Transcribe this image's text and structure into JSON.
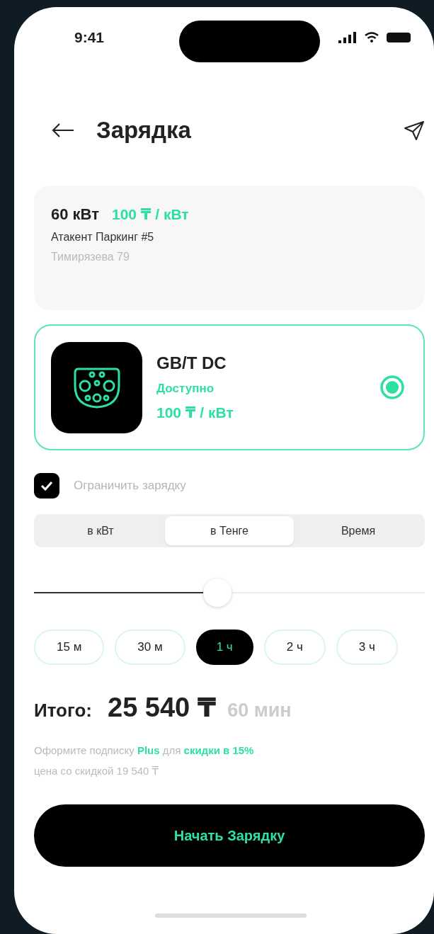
{
  "status_bar": {
    "time": "9:41"
  },
  "header": {
    "title": "Зарядка"
  },
  "station": {
    "power": "60 кВт",
    "price": "100 ₸ / кВт",
    "name": "Атакент Паркинг #5",
    "address": "Тимирязева 79"
  },
  "connectors": [
    {
      "name": "GB/T DC",
      "status": "Доступно",
      "price": "100 ₸ / кВт",
      "selected": true
    }
  ],
  "limit": {
    "label": "Ограничить зарядку",
    "checked": true
  },
  "modes": [
    {
      "label": "в кВт",
      "selected": false
    },
    {
      "label": "в Тенге",
      "selected": true
    },
    {
      "label": "Время",
      "selected": false
    }
  ],
  "slider": {
    "level": 0.47
  },
  "durations": [
    {
      "label": "15 м",
      "selected": false
    },
    {
      "label": "30 м",
      "selected": false
    },
    {
      "label": "1 ч",
      "selected": true
    },
    {
      "label": "2 ч",
      "selected": false
    },
    {
      "label": "3 ч",
      "selected": false
    }
  ],
  "total": {
    "label": "Итого:",
    "amount": "25 540 ₸",
    "duration": "60 мин"
  },
  "promo": {
    "text": "Оформите подписку **Plus** для **скидки в 15%**",
    "discount": "цена со скидкой 19 540 ₸"
  },
  "start_button": {
    "label": "Начать Зарядку"
  }
}
